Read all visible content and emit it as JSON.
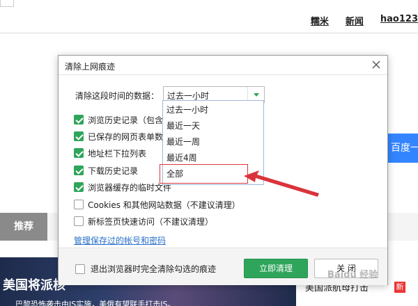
{
  "background": {
    "top_links": [
      "糯米",
      "新闻",
      "hao123"
    ],
    "search_button_label": "百度一下",
    "active_tab_label": "推荐",
    "news_headline": "美国将派核",
    "news_subline": "巴黎恐怖袭击由IS实施，美俄有望联手打击IS。",
    "news_side_text": "美国派航母打击",
    "new_badge": "新"
  },
  "dialog": {
    "title": "清除上网痕迹",
    "close_icon": "close-icon",
    "time_range_label": "清除这段时间的数据：",
    "time_range_selected": "过去一小时",
    "options": [
      {
        "label": "浏览历史记录（包含",
        "checked": true
      },
      {
        "label": "已保存的网页表单数",
        "checked": true
      },
      {
        "label": "地址栏下拉列表",
        "checked": true
      },
      {
        "label": "下载历史记录",
        "checked": true
      },
      {
        "label": "浏览器缓存的临时文件",
        "checked": true
      },
      {
        "label": "Cookies 和其他网站数据（不建议清理）",
        "checked": false
      },
      {
        "label": "新标签页快速访问（不建议清理）",
        "checked": false
      }
    ],
    "manage_link": "管理保存过的帐号和密码",
    "exit_option_label": "退出浏览器时完全清除勾选的痕迹",
    "exit_option_checked": false,
    "clear_button": "立即清理",
    "close_button": "关 闭"
  },
  "dropdown": {
    "items": [
      "过去一小时",
      "最近一天",
      "最近一周",
      "最近4周",
      "全部"
    ],
    "highlighted": "全部"
  },
  "annotation": {
    "color": "#d9343c"
  },
  "colors": {
    "accent_green": "#2fa55b",
    "link_blue": "#2a6fc9",
    "search_blue": "#3385ff"
  },
  "watermark": "Baidu 经验"
}
